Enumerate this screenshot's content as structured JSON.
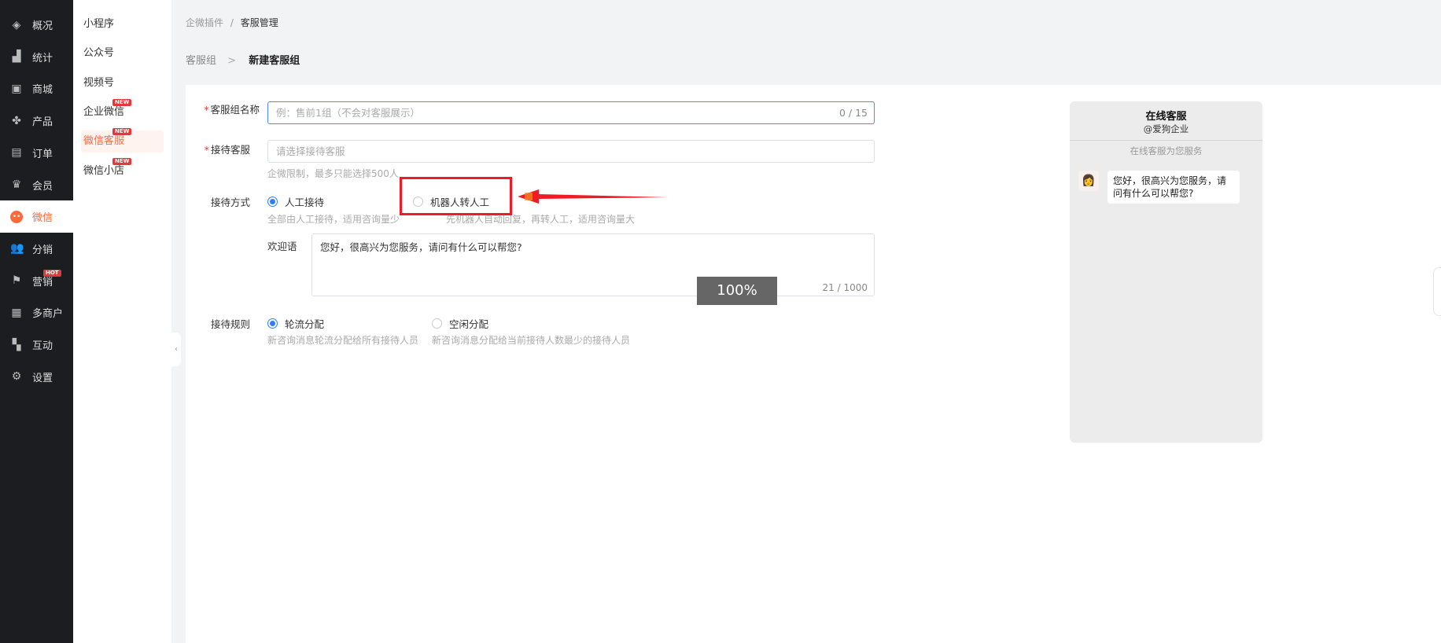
{
  "sidebar": {
    "items": [
      {
        "label": "概况",
        "icon": "layers-icon",
        "glyph": "◈"
      },
      {
        "label": "统计",
        "icon": "stats-icon",
        "glyph": "▟"
      },
      {
        "label": "商城",
        "icon": "shop-icon",
        "glyph": "▣"
      },
      {
        "label": "产品",
        "icon": "product-icon",
        "glyph": "✤"
      },
      {
        "label": "订单",
        "icon": "order-icon",
        "glyph": "▤"
      },
      {
        "label": "会员",
        "icon": "crown-icon",
        "glyph": "♛"
      },
      {
        "label": "微信",
        "icon": "wechat-icon",
        "glyph": "••"
      },
      {
        "label": "分销",
        "icon": "distribution-icon",
        "glyph": "👥"
      },
      {
        "label": "营销",
        "icon": "flag-icon",
        "glyph": "⚑",
        "badge": "HOT"
      },
      {
        "label": "多商户",
        "icon": "merchant-icon",
        "glyph": "▦"
      },
      {
        "label": "互动",
        "icon": "interact-icon",
        "glyph": "▚"
      },
      {
        "label": "设置",
        "icon": "gear-icon",
        "glyph": "⚙"
      }
    ]
  },
  "submenu": {
    "items": [
      {
        "label": "小程序"
      },
      {
        "label": "公众号"
      },
      {
        "label": "视频号"
      },
      {
        "label": "企业微信",
        "badge": "NEW"
      },
      {
        "label": "微信客服",
        "badge": "NEW"
      },
      {
        "label": "微信小店",
        "badge": "NEW"
      }
    ]
  },
  "breadcrumb": {
    "parent": "企微插件",
    "sep": "/",
    "current": "客服管理"
  },
  "title": {
    "parent": "客服组",
    "sep": ">",
    "current": "新建客服组"
  },
  "form": {
    "name_label": "客服组名称",
    "name_placeholder": "例：售前1组（不会对客服展示）",
    "name_count": "0 / 15",
    "agent_label": "接待客服",
    "agent_placeholder": "请选择接待客服",
    "agent_hint": "企微限制，最多只能选择500人",
    "mode_label": "接待方式",
    "mode_manual": "人工接待",
    "mode_manual_hint": "全部由人工接待，适用咨询量少",
    "mode_robot": "机器人转人工",
    "mode_robot_hint": "先机器人自动回复，再转人工，适用咨询量大",
    "welcome_label": "欢迎语",
    "welcome_value": "您好，很高兴为您服务，请问有什么可以帮您?",
    "welcome_count": "21 / 1000",
    "rule_label": "接待规则",
    "rule_round": "轮流分配",
    "rule_round_hint": "新咨询消息轮流分配给所有接待人员",
    "rule_idle": "空闲分配",
    "rule_idle_hint": "新咨询消息分配给当前接待人数最少的接待人员"
  },
  "preview": {
    "title": "在线客服",
    "company": "@爱狗企业",
    "subtitle": "在线客服为您服务",
    "message": "您好，很高兴为您服务，请问有什么可以帮您?"
  },
  "zoom_level": "100%",
  "colors": {
    "accent": "#ff6a3d",
    "primary": "#2d7ff9",
    "annotation": "#ee1c25"
  }
}
